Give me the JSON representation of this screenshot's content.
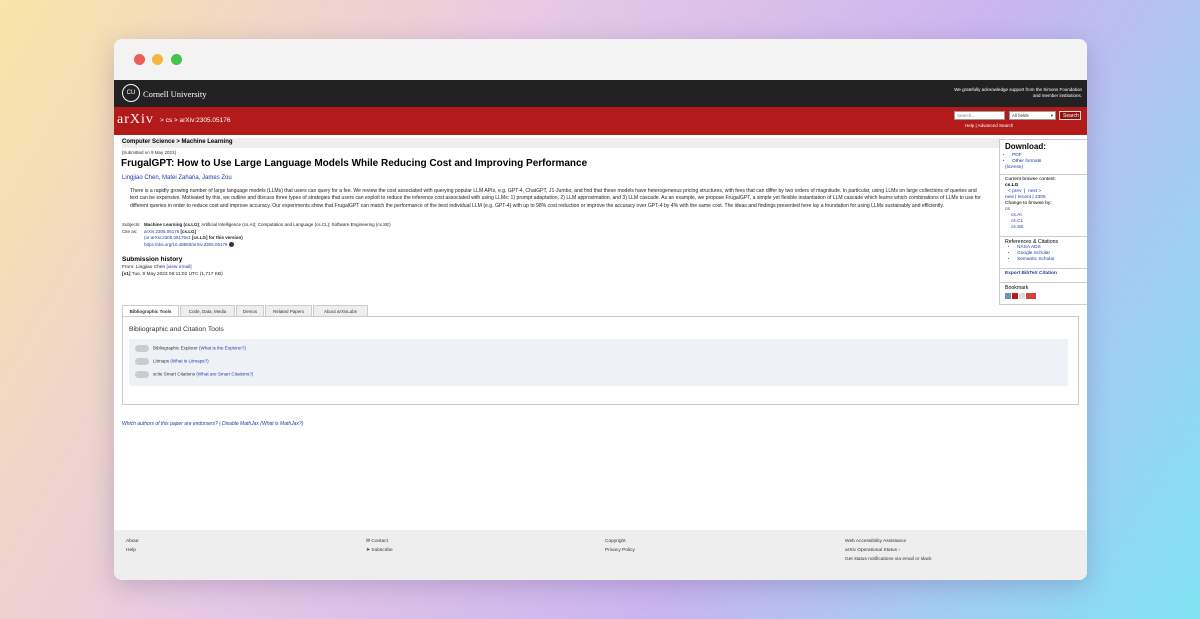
{
  "header": {
    "university": "Cornell University",
    "seal": "CU",
    "support": "We gratefully acknowledge support from the Simons Foundation and member institutions."
  },
  "nav": {
    "logo": "arXiv",
    "crumb": "> cs > arXiv:2305.05176",
    "search_placeholder": "Search...",
    "search_field": "All fields",
    "search_button": "Search",
    "help": "Help | Advanced Search"
  },
  "paper": {
    "subject": "Computer Science > Machine Learning",
    "submitted": "[Submitted on 9 May 2023]",
    "title": "FrugalGPT: How to Use Large Language Models While Reducing Cost and Improving Performance",
    "authors": "Lingjiao Chen, Matei Zaharia, James Zou",
    "abstract": "There is a rapidly growing number of large language models (LLMs) that users can query for a fee. We review the cost associated with querying popular LLM APIs, e.g. GPT-4, ChatGPT, J1-Jumbo, and find that these models have heterogeneous pricing structures, with fees that can differ by two orders of magnitude. In particular, using LLMs on large collections of queries and text can be expensive. Motivated by this, we outline and discuss three types of strategies that users can exploit to reduce the inference cost associated with using LLMs: 1) prompt adaptation, 2) LLM approximation, and 3) LLM cascade. As an example, we propose FrugalGPT, a simple yet flexible instantiation of LLM cascade which learns which combinations of LLMs to use for different queries in order to reduce cost and improve accuracy. Our experiments show that FrugalGPT can match the performance of the best individual LLM (e.g. GPT-4) with up to 98% cost reduction or improve the accuracy over GPT-4 by 4% with the same cost. The ideas and findings presented here lay a foundation for using LLMs sustainably and efficiently.",
    "subjects_label": "Subjects:",
    "subjects_main": "Machine Learning (cs.LG)",
    "subjects_rest": "; Artificial Intelligence (cs.AI); Computation and Language (cs.CL); Software Engineering (cs.SE)",
    "cite_label": "Cite as:",
    "cite1": "arXiv:2305.05176",
    "cite1b": "[cs.LG]",
    "cite2": "(or arXiv:2305.05176v1",
    "cite2b": "[cs.LG] for this version)",
    "doi": "https://doi.org/10.48550/arXiv.2305.05176",
    "history_title": "Submission history",
    "history_from": "From: Lingjiao Chen",
    "history_email": "[view email]",
    "history_v1": "[v1]",
    "history_date": "Tue, 9 May 2023 06:11:02 UTC (1,717 KB)"
  },
  "sidebar": {
    "download": "Download:",
    "formats": [
      "PDF",
      "Other formats"
    ],
    "license": "(license)",
    "ctx_label": "Current browse context:",
    "ctx": "cs.LG",
    "prev": "< prev",
    "next": "next >",
    "newrecent": "new | recent | 2305",
    "change": "Change to browse by:",
    "cs": "cs",
    "browse": [
      "cs.AI",
      "cs.CL",
      "cs.SE"
    ],
    "refs": "References & Citations",
    "refs_items": [
      "NASA ADS",
      "Google Scholar",
      "Semantic Scholar"
    ],
    "export": "Export BibTeX Citation",
    "bookmark": "Bookmark"
  },
  "tabs": [
    "Bibliographic Tools",
    "Code, Data, Media",
    "Demos",
    "Related Papers",
    "About arXivLabs"
  ],
  "tools": {
    "title": "Bibliographic and Citation Tools",
    "rows": [
      {
        "label": "Bibliographic Explorer",
        "link": "(What is the Explorer?)"
      },
      {
        "label": "Litmaps",
        "link": "(What is Litmaps?)"
      },
      {
        "label": "scite Smart Citations",
        "link": "(What are Smart Citations?)"
      }
    ]
  },
  "endorse": "Which authors of this paper are endorsers? | Disable MathJax (What is MathJax?)",
  "footer": {
    "col1": [
      "About",
      "Help"
    ],
    "col2": [
      "Contact",
      "Subscribe"
    ],
    "col3": [
      "Copyright",
      "Privacy Policy"
    ],
    "col4": [
      "Web Accessibility Assistance",
      "arXiv Operational Status",
      "Get status notifications via email or slack"
    ]
  }
}
